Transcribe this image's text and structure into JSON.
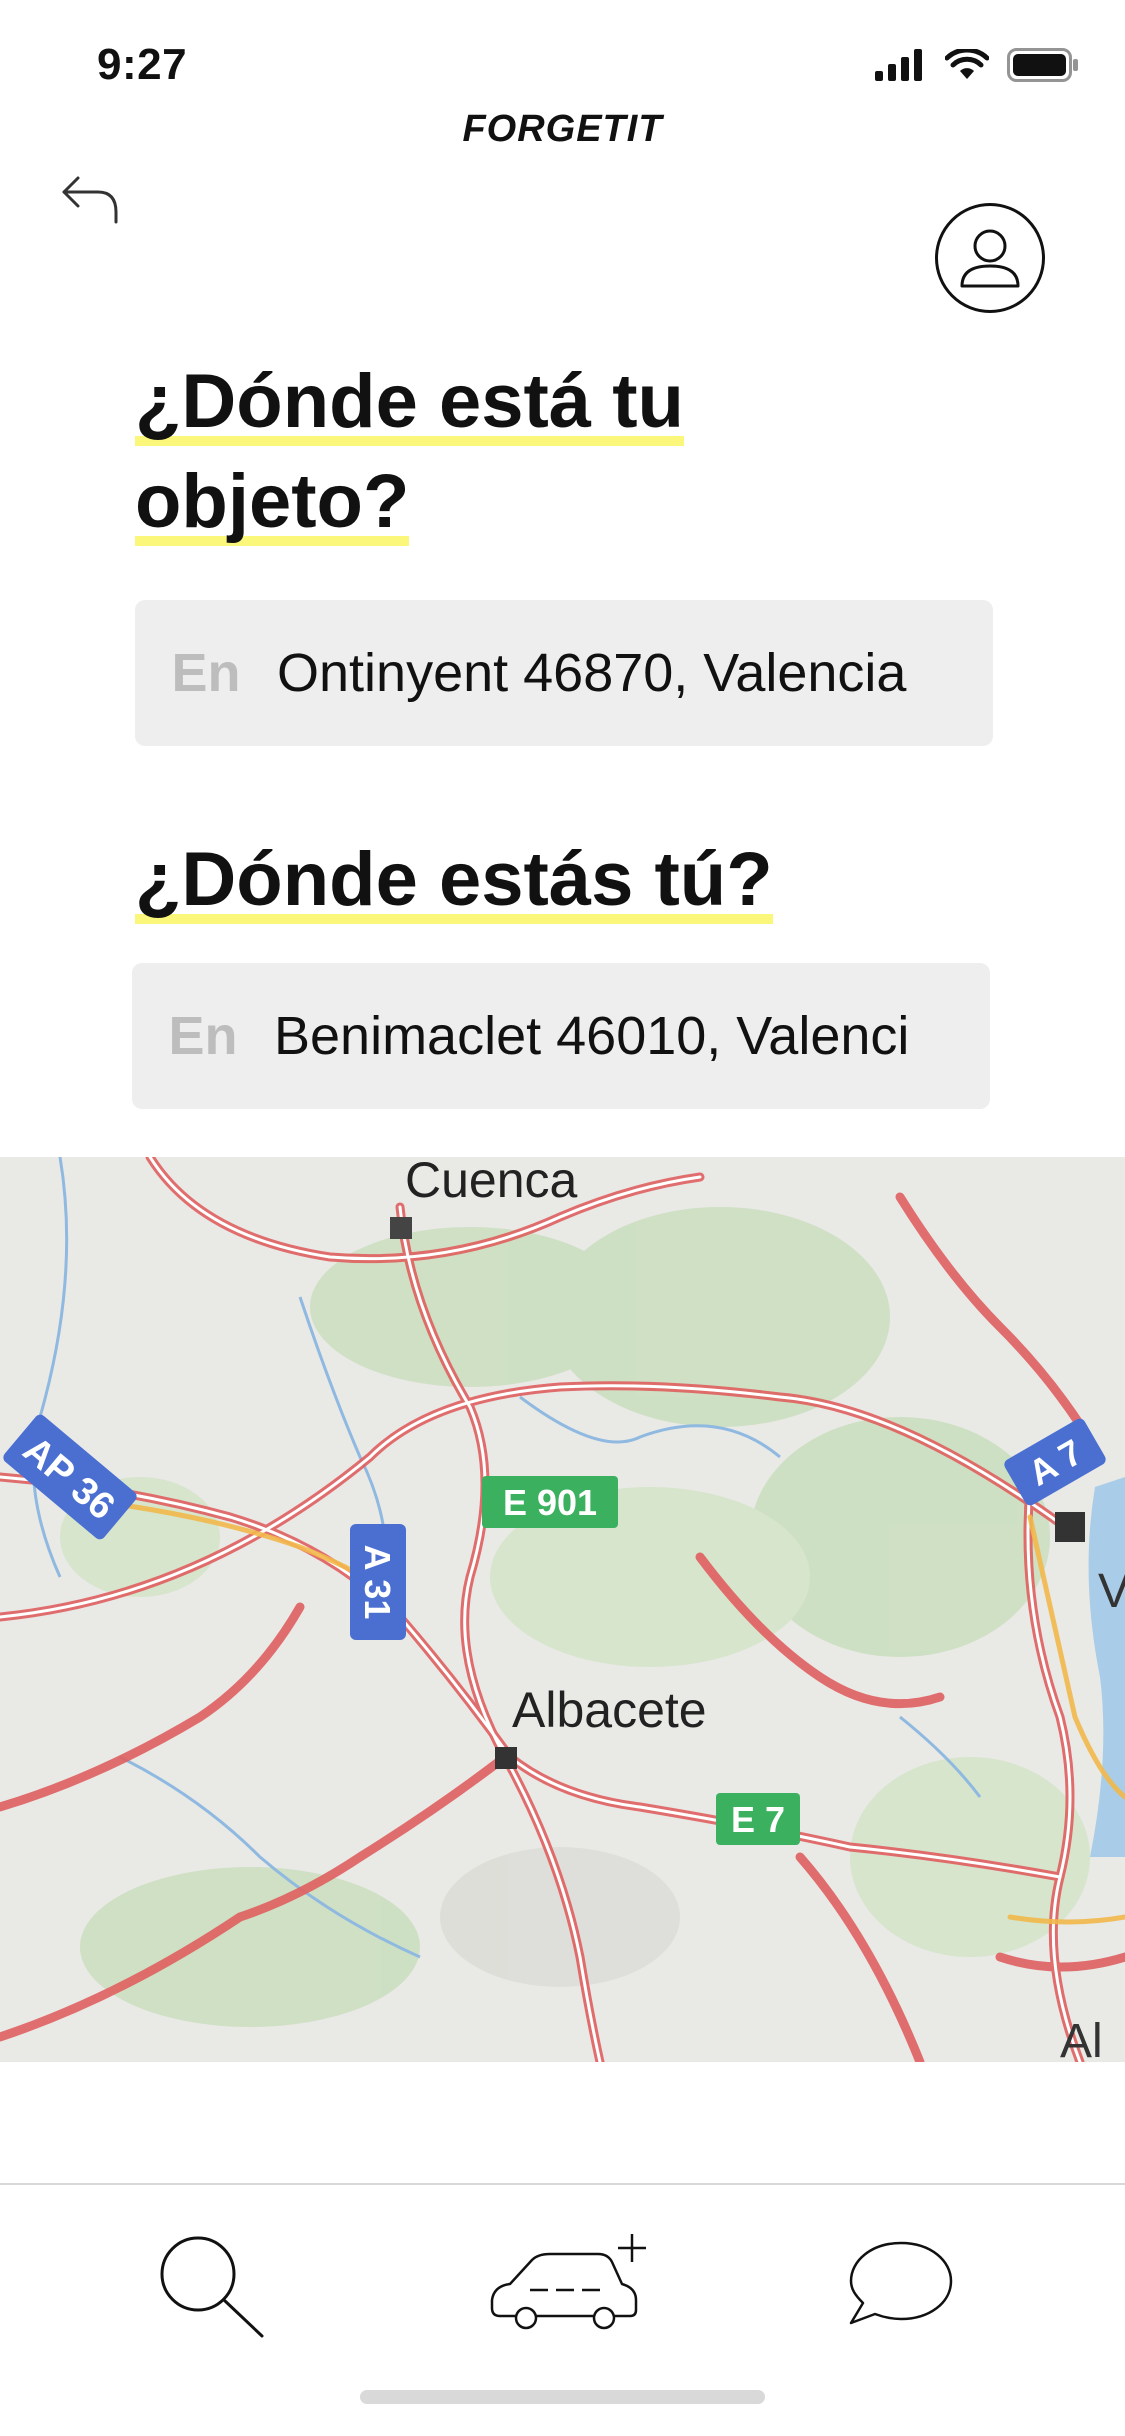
{
  "status": {
    "time": "9:27"
  },
  "brand": {
    "name": "FORGETIT"
  },
  "questions": {
    "object_line1": "¿Dónde está tu",
    "object_line2": "objeto?",
    "user": "¿Dónde estás tú?"
  },
  "fields": {
    "object_location": {
      "prefix": "En",
      "value": "Ontinyent 46870, Valencia"
    },
    "user_location": {
      "prefix": "En",
      "value": "Benimaclet 46010, Valenci"
    }
  },
  "map": {
    "cities": [
      "Cuenca",
      "Albacete"
    ],
    "road_labels": [
      "AP 36",
      "E 901",
      "A 31",
      "A 7",
      "E 7"
    ],
    "edge_labels": [
      "V",
      "Al"
    ]
  },
  "icons": {
    "back": "back-arrow-icon",
    "profile": "user-icon",
    "search": "search-icon",
    "add_car": "add-car-icon",
    "chat": "chat-icon"
  },
  "colors": {
    "highlight": "#fbf77b",
    "field_bg": "#eeeeee",
    "road": "#e06060",
    "route_sign_blue": "#4a6fd1",
    "route_sign_green": "#3bb15f"
  }
}
